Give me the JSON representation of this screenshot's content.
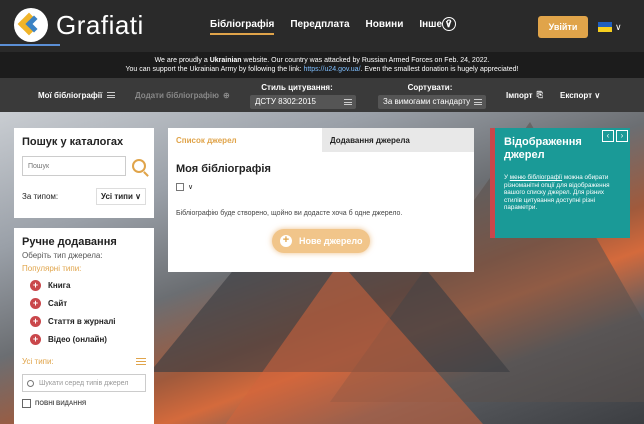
{
  "brand": {
    "name": "Grafiati"
  },
  "nav": {
    "items": [
      "Бібліографія",
      "Передплата",
      "Новини",
      "Інше ∨"
    ],
    "login": "Увійти"
  },
  "banner": {
    "line1_pre": "We are proudly a ",
    "line1_bold": "Ukrainian",
    "line1_post": " website. Our country was attacked by Russian Armed Forces on Feb. 24, 2022.",
    "line2_pre": "You can support the Ukrainian Army by following the link: ",
    "line2_link": "https://u24.gov.ua/",
    "line2_post": ". Even the smallest donation is hugely appreciated!"
  },
  "toolbar": {
    "my_bib": "Мої бібліографії",
    "add_to_bib": "Додати бібліографію",
    "citation_label": "Стиль цитування:",
    "citation_value": "ДСТУ 8302:2015",
    "sort_label": "Сортувати:",
    "sort_value": "За вимогами стандарту",
    "import": "Імпорт",
    "export": "Експорт ∨"
  },
  "search": {
    "title": "Пошук у каталогах",
    "placeholder": "Пошук",
    "type_label": "За типом:",
    "type_value": "Усі типи ∨"
  },
  "manual": {
    "title": "Ручне додавання",
    "subtitle": "Оберіть тип джерела:",
    "popular": "Популярні типи:",
    "items": [
      "Книга",
      "Сайт",
      "Стаття в журналі",
      "Відео (онлайн)"
    ],
    "all_types": "Усі типи:",
    "type_search_placeholder": "Шукати серед типів джерел",
    "full_editions": "ПОВНІ ВИДАННЯ"
  },
  "center": {
    "tab_list": "Список джерел",
    "tab_add": "Додавання джерела",
    "title": "Моя бібліографія",
    "empty_msg": "Бібліографію буде створено, щойно ви додасте хоча б одне джерело.",
    "new_source": "Нове джерело"
  },
  "teal": {
    "title": "Відображення джерел",
    "text_pre": "У ",
    "text_link": "меню бібліографії",
    "text_post": " можна обирати різноманітні опції для відображення вашого списку джерел. Для різних стилів цитування доступні різні параметри."
  },
  "colors": {
    "accent": "#e0a44a",
    "teal": "#1a9a97",
    "red": "#c9474b"
  }
}
